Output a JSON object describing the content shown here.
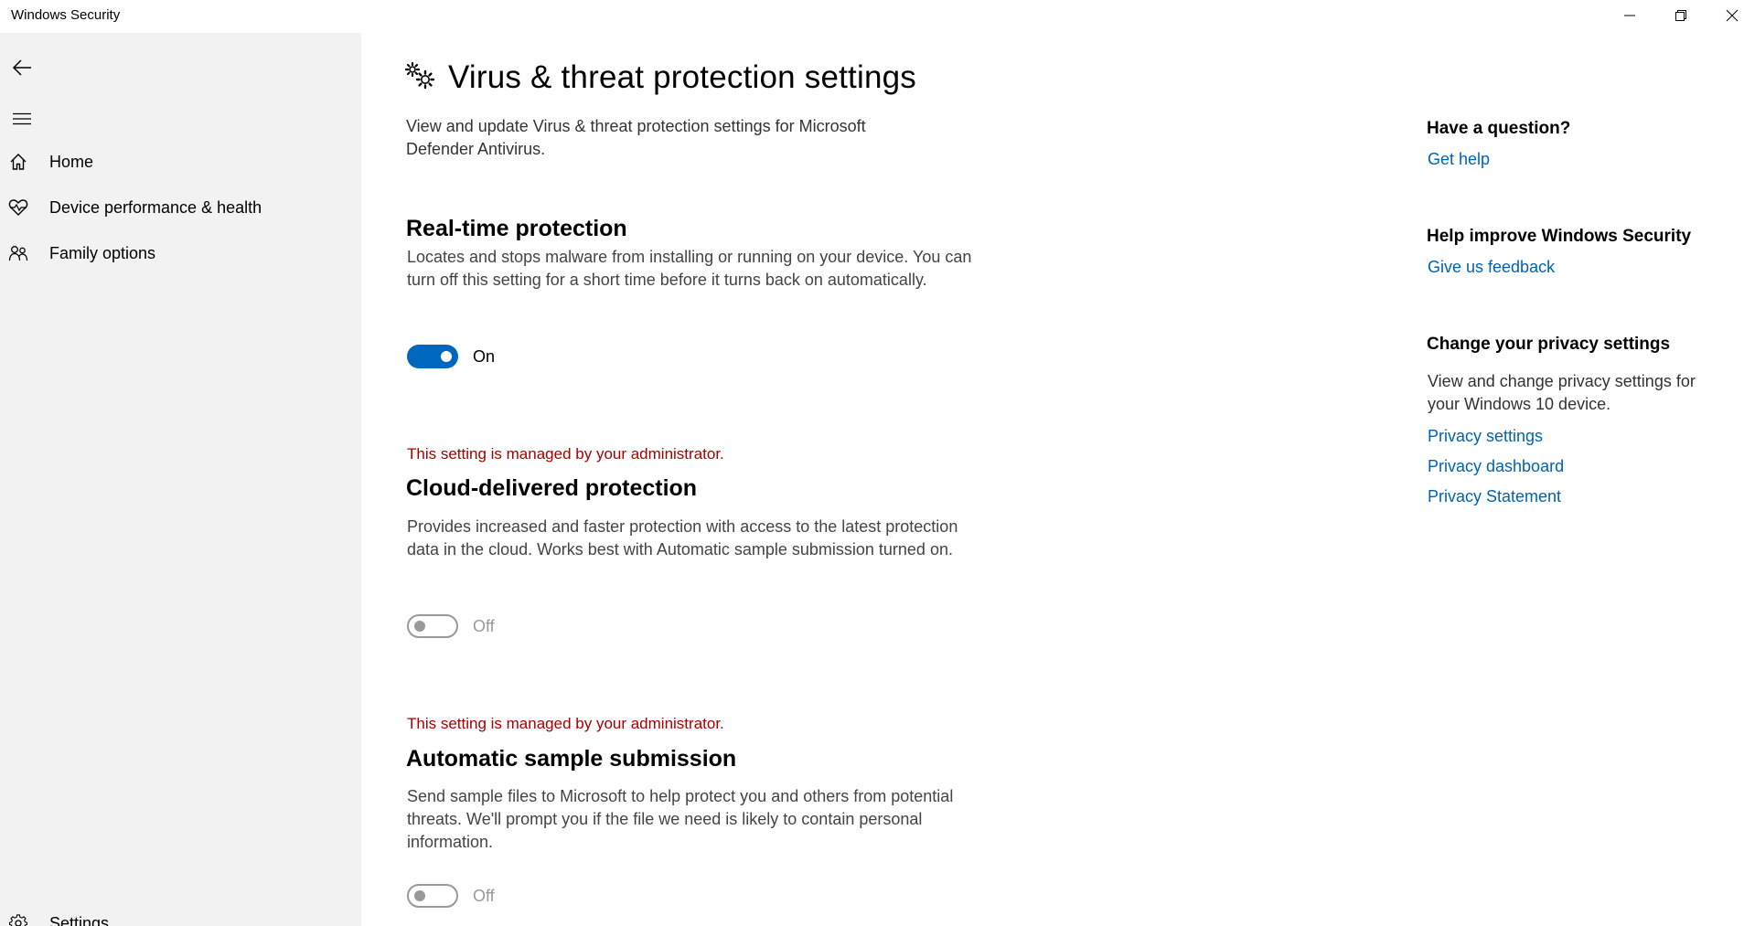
{
  "window": {
    "title": "Windows Security",
    "controls": [
      "minimize-icon",
      "restore-icon",
      "close-icon"
    ]
  },
  "sidebar": {
    "back_icon": "back-arrow-icon",
    "menu_icon": "hamburger-icon",
    "items": [
      {
        "label": "Home",
        "icon": "home-icon"
      },
      {
        "label": "Device performance & health",
        "icon": "heart-icon"
      },
      {
        "label": "Family options",
        "icon": "family-icon"
      }
    ],
    "settings": {
      "label": "Settings",
      "icon": "gear-icon"
    }
  },
  "main": {
    "title": "Virus & threat protection settings",
    "title_icon": "gears-icon",
    "description": "View and update Virus & threat protection settings for Microsoft Defender Antivirus.",
    "sections": [
      {
        "admin_note": "",
        "title": "Real-time protection",
        "description": "Locates and stops malware from installing or running on your device. You can turn off this setting for a short time before it turns back on automatically.",
        "toggle_on": true,
        "toggle_label": "On"
      },
      {
        "admin_note": "This setting is managed by your administrator.",
        "title": "Cloud-delivered protection",
        "description": "Provides increased and faster protection with access to the latest protection data in the cloud. Works best with Automatic sample submission turned on.",
        "toggle_on": false,
        "toggle_label": "Off"
      },
      {
        "admin_note": "This setting is managed by your administrator.",
        "title": "Automatic sample submission",
        "description": "Send sample files to Microsoft to help protect you and others from potential threats. We'll prompt you if the file we need is likely to contain personal information.",
        "toggle_on": false,
        "toggle_label": "Off"
      }
    ]
  },
  "right_panel": {
    "question": {
      "heading": "Have a question?",
      "link": "Get help"
    },
    "improve": {
      "heading": "Help improve Windows Security",
      "link": "Give us feedback"
    },
    "privacy": {
      "heading": "Change your privacy settings",
      "text": "View and change privacy settings for your Windows 10 device.",
      "links": [
        "Privacy settings",
        "Privacy dashboard",
        "Privacy Statement"
      ]
    }
  },
  "colors": {
    "accent": "#0067c0",
    "link": "#0063b1",
    "admin_note": "#a80000",
    "sidebar_bg": "#f2f2f2"
  }
}
